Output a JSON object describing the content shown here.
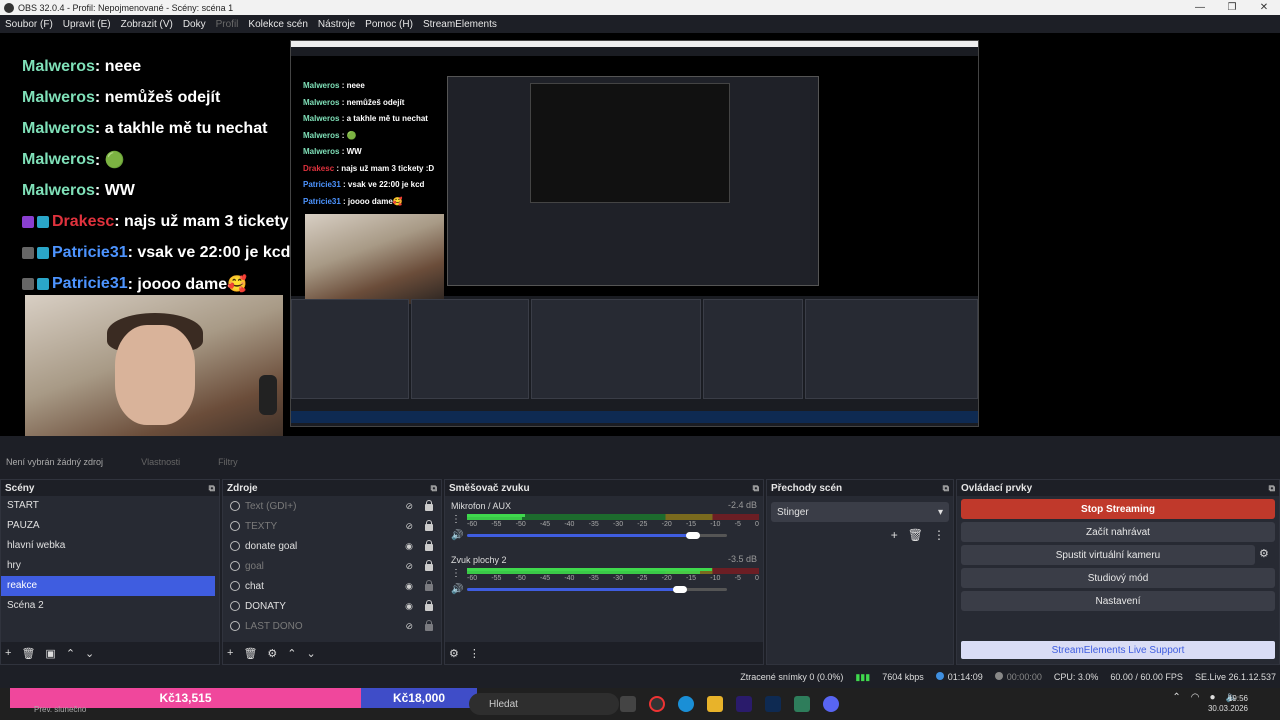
{
  "window": {
    "title": "OBS 32.0.4 - Profil: Nepojmenované - Scény: scéna 1",
    "controls": [
      "—",
      "❐",
      "✕"
    ]
  },
  "menu": [
    {
      "label": "Soubor (F)",
      "dim": false
    },
    {
      "label": "Upravit (E)",
      "dim": false
    },
    {
      "label": "Zobrazit (V)",
      "dim": false
    },
    {
      "label": "Doky",
      "dim": false
    },
    {
      "label": "Profil",
      "dim": true
    },
    {
      "label": "Kolekce scén",
      "dim": false
    },
    {
      "label": "Nástroje",
      "dim": false
    },
    {
      "label": "Pomoc (H)",
      "dim": false
    },
    {
      "label": "StreamElements",
      "dim": false
    }
  ],
  "preview_chat": [
    {
      "user": "Malweros",
      "text": " : neee",
      "color": "green"
    },
    {
      "user": "Malweros",
      "text": " : nemůžeš odejít",
      "color": "green"
    },
    {
      "user": "Malweros",
      "text": " : a takhle mě tu nechat",
      "color": "green"
    },
    {
      "user": "Malweros",
      "text": " : 🟢",
      "color": "green"
    },
    {
      "user": "Malweros",
      "text": " : WW",
      "color": "green"
    },
    {
      "user": "Drakesc",
      "text": " : najs už mam 3 tickety :D",
      "color": "red"
    },
    {
      "user": "Patricie31",
      "text": " : vsak ve 22:00 je kcd",
      "color": "blue"
    },
    {
      "user": "Patricie31",
      "text": " : joooo dame🥰",
      "color": "blue"
    }
  ],
  "properties_bar": {
    "no_source": "Není vybrán žádný zdroj",
    "properties": "Vlastnosti",
    "filters": "Filtry"
  },
  "scenes": {
    "title": "Scény",
    "items": [
      "START",
      "PAUZA",
      "hlavní webka",
      "hry",
      "reakce",
      "Scéna 2"
    ],
    "selected_index": 4,
    "footer": [
      "+",
      "🗑",
      "▣",
      "⌃",
      "⌄"
    ]
  },
  "sources": {
    "title": "Zdroje",
    "items": [
      {
        "label": "Text (GDI+)",
        "visible": false
      },
      {
        "label": "TEXTY",
        "visible": false
      },
      {
        "label": "donate goal",
        "visible": true
      },
      {
        "label": "goal",
        "visible": false
      },
      {
        "label": "chat",
        "visible": true
      },
      {
        "label": "DONATY",
        "visible": true
      },
      {
        "label": "LAST DONO",
        "visible": false
      }
    ],
    "footer": [
      "+",
      "🗑",
      "⚙",
      "⌃",
      "⌄"
    ]
  },
  "mixer": {
    "title": "Směšovač zvuku",
    "scale": [
      "-60",
      "-55",
      "-50",
      "-45",
      "-40",
      "-35",
      "-30",
      "-25",
      "-20",
      "-15",
      "-10",
      "-5",
      "0"
    ],
    "channels": [
      {
        "name": "Mikrofon / AUX",
        "db": "-2.4 dB",
        "level": 0.2,
        "volume": 0.87
      },
      {
        "name": "Zvuk plochy 2",
        "db": "-3.5 dB",
        "level": 0.84,
        "volume": 0.82
      }
    ],
    "footer": [
      "⚙",
      "⋮"
    ]
  },
  "transitions": {
    "title": "Přechody scén",
    "selected": "Stinger",
    "buttons": [
      "+",
      "🗑",
      "⋮"
    ]
  },
  "controls": {
    "title": "Ovládací prvky",
    "stop_streaming": "Stop Streaming",
    "start_recording": "Začít nahrávat",
    "virtual_camera": "Spustit virtuální kameru",
    "studio_mode": "Studiový mód",
    "settings": "Nastavení",
    "se_support": "StreamElements Live Support"
  },
  "status": {
    "dropped_frames": "Ztracené snímky 0 (0.0%)",
    "bitrate": "7604 kbps",
    "stream_time": "01:14:09",
    "record_time": "00:00:00",
    "cpu": "CPU: 3.0%",
    "fps": "60.00 / 60.00 FPS",
    "version": "SE.Live 26.1.12.537"
  },
  "taskbar": {
    "donation_left": "Kč13,515",
    "donation_right": "Kč18,000",
    "widget": "Prev. slunečno",
    "search": "Hledat",
    "time": "19:56",
    "date": "30.03.2026"
  },
  "colors": {
    "accent": "#3f5de0",
    "stop": "#c0392b",
    "pink": "#f0479c"
  }
}
